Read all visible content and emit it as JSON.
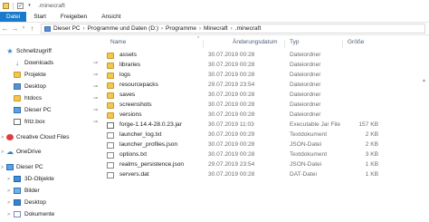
{
  "window": {
    "title": ".minecraft",
    "check_glyph": "✓",
    "dropdown_glyph": "▾"
  },
  "ribbon": {
    "tabs": [
      {
        "label": "Datei",
        "active": true
      },
      {
        "label": "Start",
        "active": false
      },
      {
        "label": "Freigeben",
        "active": false
      },
      {
        "label": "Ansicht",
        "active": false
      }
    ]
  },
  "address": {
    "back_glyph": "←",
    "forward_glyph": "→",
    "recent_glyph": "˅",
    "up_glyph": "↑",
    "breadcrumb": [
      "Dieser PC",
      "Programme und Daten (D:)",
      "Programme",
      "Minecraft",
      ".minecraft"
    ],
    "sep_glyph": "›"
  },
  "nav_pane": {
    "pin_glyph": "📌",
    "arrow_glyph": ">",
    "items": [
      {
        "label": "Schnellzugriff",
        "icon": "star-icon",
        "indent": 0,
        "pinned": false
      },
      {
        "label": "Downloads",
        "icon": "download-icon",
        "indent": 1,
        "pinned": true
      },
      {
        "label": "Projekte",
        "icon": "folder-icon",
        "indent": 1,
        "pinned": true
      },
      {
        "label": "Desktop",
        "icon": "folder-blue-icon",
        "indent": 1,
        "pinned": true
      },
      {
        "label": "htdocs",
        "icon": "folder-icon",
        "indent": 1,
        "pinned": true
      },
      {
        "label": "Dieser PC",
        "icon": "computer-icon",
        "indent": 1,
        "pinned": true
      },
      {
        "label": "fritz.box",
        "icon": "network-drive-icon",
        "indent": 1,
        "pinned": true
      },
      {
        "label": "Creative Cloud Files",
        "icon": "creative-cloud-icon",
        "indent": 0,
        "pinned": false,
        "expander": true
      },
      {
        "label": "OneDrive",
        "icon": "cloud-icon",
        "indent": 0,
        "pinned": false,
        "expander": true
      },
      {
        "label": "Dieser PC",
        "icon": "computer-icon",
        "indent": 0,
        "pinned": false,
        "expander": true
      },
      {
        "label": "3D-Objekte",
        "icon": "cube-icon",
        "indent": 1,
        "pinned": false,
        "expander": true
      },
      {
        "label": "Bilder",
        "icon": "pictures-icon",
        "indent": 1,
        "pinned": false,
        "expander": true
      },
      {
        "label": "Desktop",
        "icon": "desktop-icon",
        "indent": 1,
        "pinned": false,
        "expander": true
      },
      {
        "label": "Dokumente",
        "icon": "documents-icon",
        "indent": 1,
        "pinned": false,
        "expander": true
      }
    ]
  },
  "file_list": {
    "columns": {
      "name": "Name",
      "date": "Änderungsdatum",
      "type": "Typ",
      "size": "Größe"
    },
    "sort_glyph": "^",
    "scroll_glyph": "▲",
    "rows": [
      {
        "name": "assets",
        "date": "30.07.2019 00:28",
        "type": "Dateiordner",
        "size": "",
        "icon": "folder-icon"
      },
      {
        "name": "libraries",
        "date": "30.07.2019 00:28",
        "type": "Dateiordner",
        "size": "",
        "icon": "folder-icon"
      },
      {
        "name": "logs",
        "date": "30.07.2019 00:28",
        "type": "Dateiordner",
        "size": "",
        "icon": "folder-icon"
      },
      {
        "name": "resourcepacks",
        "date": "29.07.2019 23:54",
        "type": "Dateiordner",
        "size": "",
        "icon": "folder-icon"
      },
      {
        "name": "saves",
        "date": "30.07.2019 00:28",
        "type": "Dateiordner",
        "size": "",
        "icon": "folder-icon"
      },
      {
        "name": "screenshots",
        "date": "30.07.2019 00:28",
        "type": "Dateiordner",
        "size": "",
        "icon": "folder-icon"
      },
      {
        "name": "versions",
        "date": "30.07.2019 00:28",
        "type": "Dateiordner",
        "size": "",
        "icon": "folder-icon"
      },
      {
        "name": "forge-1.14.4-28.0.23.jar",
        "date": "30.07.2019 11:03",
        "type": "Executable Jar File",
        "size": "157 KB",
        "icon": "jar-file-icon"
      },
      {
        "name": "launcher_log.txt",
        "date": "30.07.2019 00:29",
        "type": "Textdokument",
        "size": "2 KB",
        "icon": "text-file-icon"
      },
      {
        "name": "launcher_profiles.json",
        "date": "30.07.2019 00:28",
        "type": "JSON-Datei",
        "size": "2 KB",
        "icon": "text-file-icon"
      },
      {
        "name": "options.txt",
        "date": "30.07.2019 00:28",
        "type": "Textdokument",
        "size": "3 KB",
        "icon": "text-file-icon"
      },
      {
        "name": "realms_persistence.json",
        "date": "29.07.2019 23:54",
        "type": "JSON-Datei",
        "size": "1 KB",
        "icon": "text-file-icon"
      },
      {
        "name": "servers.dat",
        "date": "30.07.2019 00:28",
        "type": "DAT-Datei",
        "size": "1 KB",
        "icon": "text-file-icon"
      }
    ]
  }
}
